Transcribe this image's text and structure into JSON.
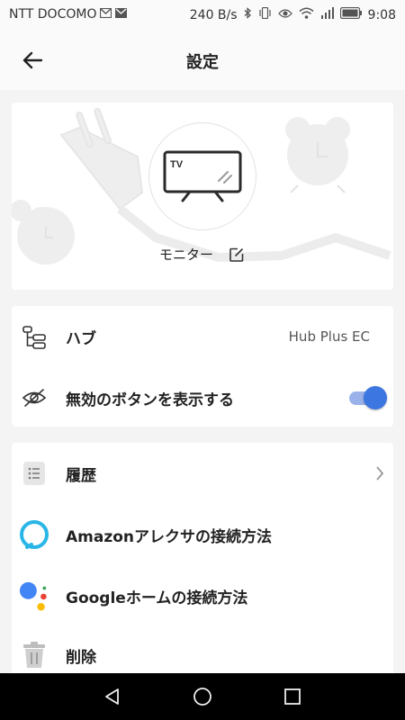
{
  "status_bar": {
    "carrier": "NTT DOCOMO",
    "speed": "240 B/s",
    "time": "9:08"
  },
  "header": {
    "title": "設定",
    "back_icon": "arrow-left-icon"
  },
  "device": {
    "icon_label": "TV",
    "name": "モニター",
    "edit_icon": "edit-icon"
  },
  "general_section": {
    "hub_label": "ハブ",
    "hub_value": "Hub Plus EC",
    "hidden_buttons_label": "無効のボタンを表示する",
    "hidden_buttons_enabled": true,
    "accent_color": "#3b76e1"
  },
  "menu_section": {
    "items": [
      {
        "label": "履歴",
        "icon": "list-icon"
      },
      {
        "label": "Amazonアレクサの接続方法",
        "icon": "alexa-icon"
      },
      {
        "label": "Googleホームの接続方法",
        "icon": "google-assistant-icon"
      },
      {
        "label": "削除",
        "icon": "trash-icon"
      }
    ]
  }
}
